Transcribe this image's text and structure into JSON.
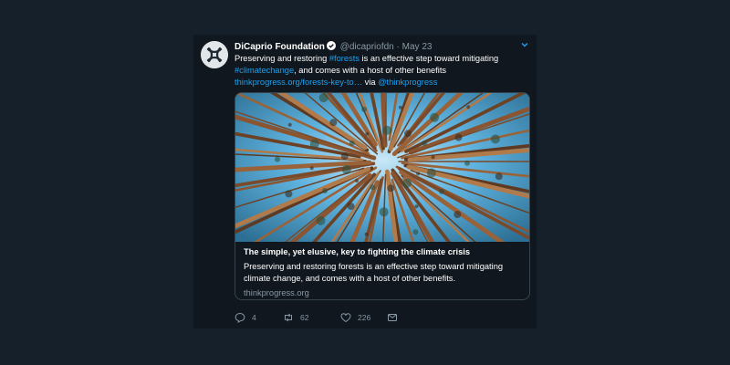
{
  "tweet": {
    "author": {
      "name": "DiCaprio Foundation",
      "handle": "@dicapriofdn",
      "separator": "·",
      "date": "May 23"
    },
    "text": {
      "part1": "Preserving and restoring ",
      "hashtag1": "#forests",
      "part2": " is an effective step toward mitigating",
      "hashtag2": "#climatechange",
      "part3": ", and comes with a host of other benefits",
      "url": "thinkprogress.org/forests-key-to…",
      "via": " via ",
      "mention": "@thinkprogress"
    },
    "card": {
      "title": "The simple, yet elusive, key to fighting the climate crisis",
      "description": "Preserving and restoring forests is an effective step toward mitigating climate change, and comes with a host of other benefits.",
      "domain": "thinkprogress.org"
    },
    "actions": {
      "replies": "4",
      "retweets": "62",
      "likes": "226"
    }
  },
  "colors": {
    "page_background": "#15202b",
    "tweet_background": "#10171e",
    "link": "#1da1f2",
    "muted": "#8899a6",
    "border": "#38444d"
  },
  "icons": {
    "avatar": "dicaprio-foundation-logo",
    "verified": "verified-badge-icon",
    "caret": "chevron-down-icon",
    "reply": "reply-icon",
    "retweet": "retweet-icon",
    "like": "heart-icon",
    "dm": "envelope-icon"
  }
}
